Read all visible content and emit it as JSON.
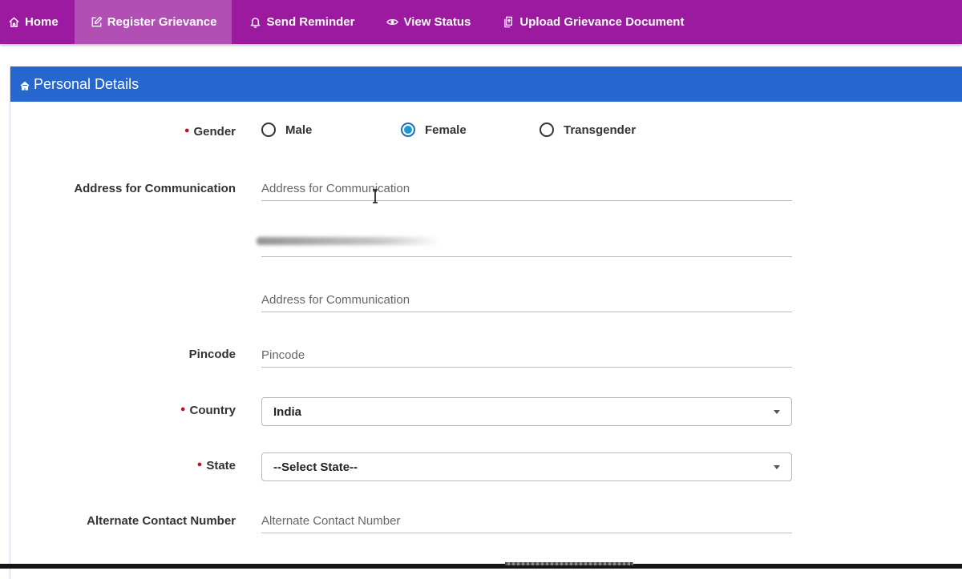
{
  "nav": {
    "items": [
      {
        "label": "Home",
        "icon": "home-icon"
      },
      {
        "label": "Register Grievance",
        "icon": "edit-icon",
        "active": true
      },
      {
        "label": "Send Reminder",
        "icon": "bell-icon"
      },
      {
        "label": "View Status",
        "icon": "eye-icon"
      },
      {
        "label": "Upload Grievance Document",
        "icon": "upload-document-icon"
      }
    ]
  },
  "panel": {
    "title": "Personal Details",
    "title_icon": "home-icon"
  },
  "form": {
    "gender": {
      "label": "Gender",
      "required": true,
      "options": [
        "Male",
        "Female",
        "Transgender"
      ],
      "selected": "Female"
    },
    "address": {
      "label": "Address for Communication",
      "line1_placeholder": "Address for Communication",
      "line2_placeholder": "Address for Communication",
      "line3_placeholder": "Address for Communication"
    },
    "pincode": {
      "label": "Pincode",
      "placeholder": "Pincode"
    },
    "country": {
      "label": "Country",
      "required": true,
      "value": "India"
    },
    "state": {
      "label": "State",
      "required": true,
      "value": "--Select State--"
    },
    "alt_contact": {
      "label": "Alternate Contact Number",
      "placeholder": "Alternate Contact Number"
    }
  },
  "colors": {
    "nav_bg": "#9b1a9f",
    "nav_active": "#b14fb4",
    "panel_header": "#2567cf",
    "radio_selected": "#1a9bd6",
    "required": "#c0141b"
  }
}
